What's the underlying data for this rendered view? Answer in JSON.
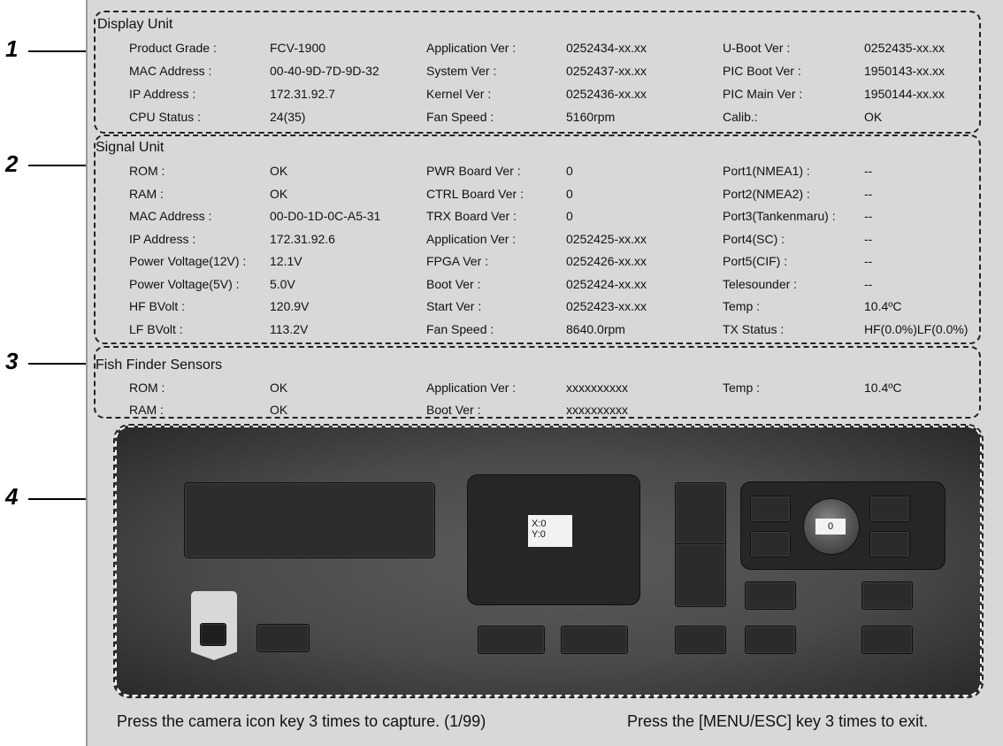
{
  "callouts": [
    "1",
    "2",
    "3",
    "4"
  ],
  "display_unit": {
    "title": "Display Unit",
    "rows": [
      [
        "Product Grade :",
        "FCV-1900",
        "Application Ver :",
        "0252434-xx.xx",
        "U-Boot Ver :",
        "0252435-xx.xx"
      ],
      [
        "MAC Address :",
        "00-40-9D-7D-9D-32",
        "System Ver :",
        "0252437-xx.xx",
        "PIC Boot Ver :",
        "1950143-xx.xx"
      ],
      [
        "IP Address :",
        "172.31.92.7",
        "Kernel Ver :",
        "0252436-xx.xx",
        "PIC Main Ver :",
        "1950144-xx.xx"
      ],
      [
        "CPU Status :",
        "24(35)",
        "Fan Speed :",
        "5160rpm",
        "Calib.:",
        "OK"
      ]
    ]
  },
  "signal_unit": {
    "title": "Signal Unit",
    "rows": [
      [
        "ROM :",
        "OK",
        "PWR Board Ver :",
        "0",
        "Port1(NMEA1) :",
        "--"
      ],
      [
        "RAM :",
        "OK",
        "CTRL Board Ver :",
        "0",
        "Port2(NMEA2) :",
        "--"
      ],
      [
        "MAC Address :",
        "00-D0-1D-0C-A5-31",
        "TRX Board Ver :",
        "0",
        "Port3(Tankenmaru) :",
        "--"
      ],
      [
        "IP Address :",
        "172.31.92.6",
        "Application Ver :",
        "0252425-xx.xx",
        "Port4(SC) :",
        "--"
      ],
      [
        "Power Voltage(12V) :",
        "12.1V",
        "FPGA Ver :",
        "0252426-xx.xx",
        "Port5(CIF) :",
        "--"
      ],
      [
        "Power Voltage(5V) :",
        "5.0V",
        "Boot Ver :",
        "0252424-xx.xx",
        "Telesounder :",
        "--"
      ],
      [
        "HF BVolt :",
        "120.9V",
        "Start Ver :",
        "0252423-xx.xx",
        "Temp :",
        "10.4ºC"
      ],
      [
        "LF BVolt :",
        "113.2V",
        "Fan Speed :",
        "8640.0rpm",
        "TX Status :",
        "HF(0.0%)LF(0.0%)"
      ]
    ]
  },
  "fish_finder": {
    "title": "Fish Finder Sensors",
    "rows": [
      [
        "ROM :",
        "OK",
        "Application Ver :",
        "xxxxxxxxxx",
        "Temp :",
        "10.4ºC"
      ],
      [
        "RAM :",
        "OK",
        "Boot Ver :",
        "xxxxxxxxxx",
        "",
        ""
      ]
    ]
  },
  "device": {
    "trackpad_x": "X:0",
    "trackpad_y": "Y:0",
    "knob_value": "0"
  },
  "footer": {
    "left": "Press the camera icon key 3 times to capture. (1/99)",
    "right": "Press the [MENU/ESC] key 3 times to exit."
  }
}
